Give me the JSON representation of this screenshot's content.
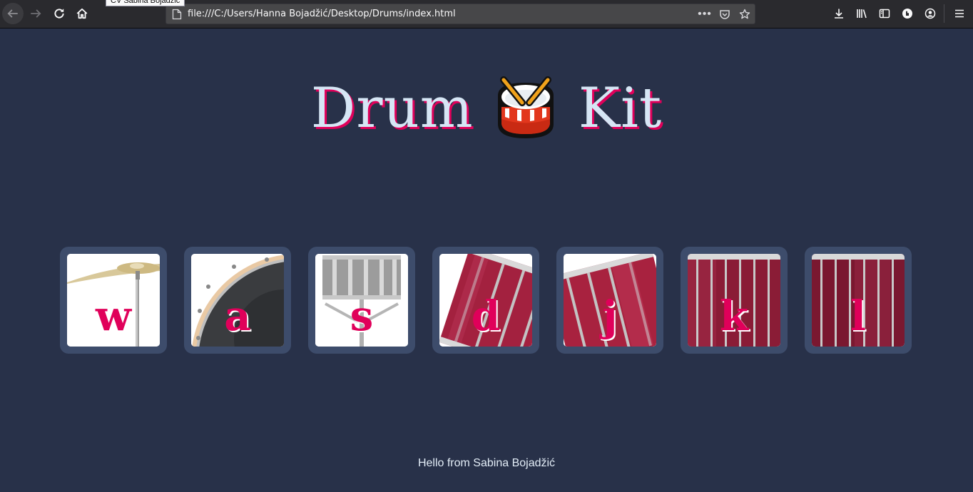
{
  "browser": {
    "url": "file:///C:/Users/Hanna Bojadžić/Desktop/Drums/index.html",
    "tooltip": "CV Sabina Bojadžić",
    "url_more": "•••"
  },
  "page": {
    "title_left": "Drum",
    "title_right": "Kit",
    "title_icon": "drum-emoji",
    "footer": "Hello from Sabina Bojadžić",
    "accent_color": "#e0005a",
    "background_color": "#283149"
  },
  "keys": [
    {
      "letter": "w",
      "image": "crash-cymbal"
    },
    {
      "letter": "a",
      "image": "kick-drum"
    },
    {
      "letter": "s",
      "image": "snare-drum"
    },
    {
      "letter": "d",
      "image": "tom-1"
    },
    {
      "letter": "j",
      "image": "tom-2"
    },
    {
      "letter": "k",
      "image": "tom-3"
    },
    {
      "letter": "l",
      "image": "tom-4"
    }
  ]
}
